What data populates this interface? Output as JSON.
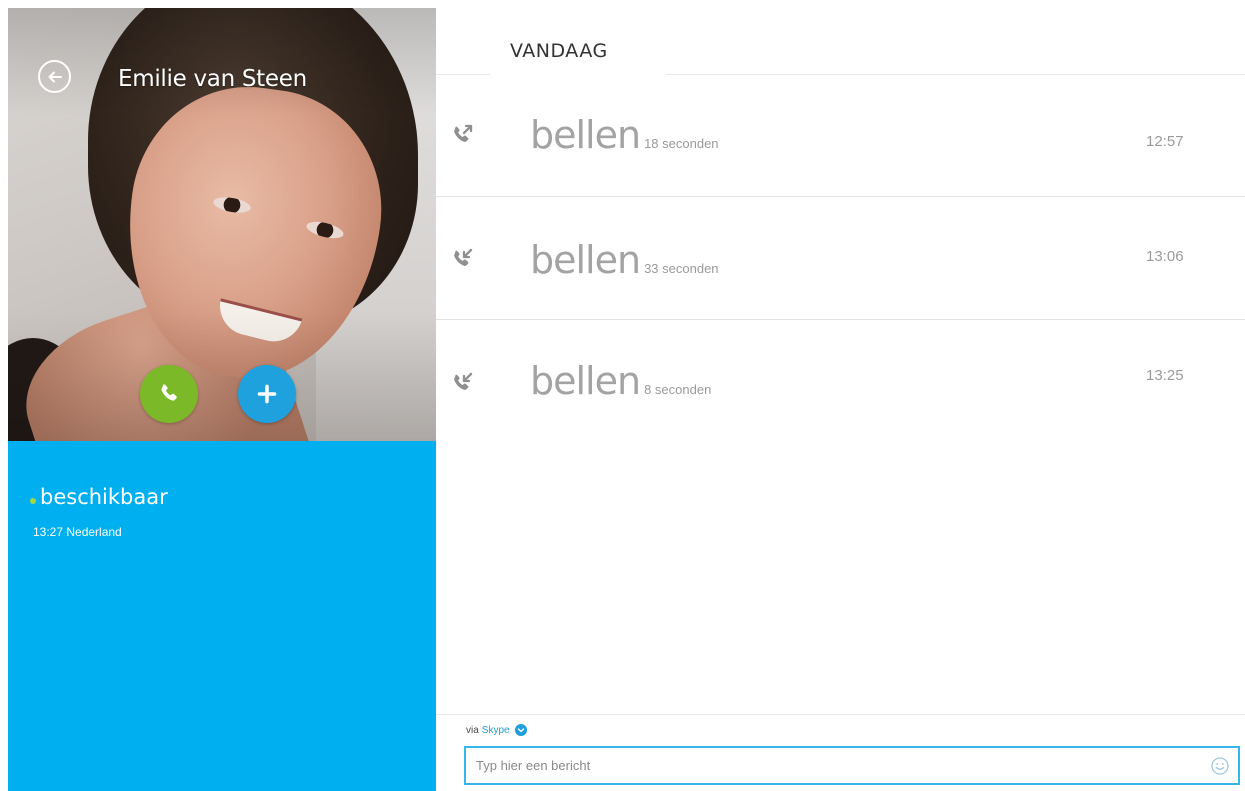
{
  "contact": {
    "name": "Emilie van Steen",
    "status": "beschikbaar",
    "local_time_location": "13:27 Nederland"
  },
  "history": {
    "date_header": "VANDAAG",
    "calls": [
      {
        "direction": "outgoing",
        "icon": "outgoing-call-icon",
        "label": "bellen",
        "duration": "18 seconden",
        "time": "12:57"
      },
      {
        "direction": "incoming",
        "icon": "incoming-call-icon",
        "label": "bellen",
        "duration": "33 seconden",
        "time": "13:06"
      },
      {
        "direction": "incoming",
        "icon": "incoming-call-icon",
        "label": "bellen",
        "duration": "8 seconden",
        "time": "13:25"
      }
    ]
  },
  "composer": {
    "via_prefix": "via",
    "via_service": "Skype",
    "placeholder": "Typ hier een bericht"
  },
  "colors": {
    "status_panel": "#00aff0",
    "call_button": "#7cb928",
    "add_button": "#1fa1dd",
    "available_dot": "#9ed94a",
    "input_border": "#36b7ea"
  }
}
